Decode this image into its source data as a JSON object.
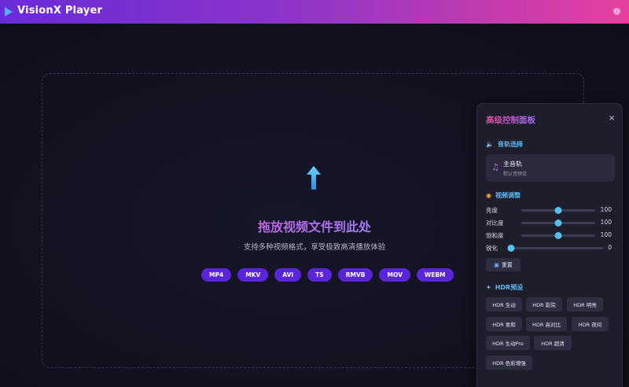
{
  "header": {
    "title": "VisionX Player",
    "logo_icon": "play-triangle-icon",
    "settings_icon": "gear-icon"
  },
  "colors": {
    "header_gradient": [
      "#6a2bd9",
      "#e840a0"
    ],
    "accent_blue": "#56bff2",
    "chip_purple": "#5a25d8"
  },
  "dropzone": {
    "icon": "upload-arrow-icon",
    "title": "拖放视频文件到此处",
    "subtitle": "支持多种视频格式，享受极致高清播放体验",
    "formats": [
      "MP4",
      "MKV",
      "AVI",
      "TS",
      "RMVB",
      "MOV",
      "WEBM"
    ]
  },
  "panel": {
    "title": "高级控制面板",
    "close_label": "×",
    "audio": {
      "heading": "音轨选择",
      "icon": "speaker-icon",
      "track_icon": "music-note-icon",
      "track_name": "主音轨",
      "track_desc": "默认音频流"
    },
    "video": {
      "heading": "视频调整",
      "icon": "palette-icon",
      "rows": [
        {
          "label": "亮度",
          "value": "100",
          "level": 0.5
        },
        {
          "label": "对比度",
          "value": "100",
          "level": 0.5
        },
        {
          "label": "饱和度",
          "value": "100",
          "level": 0.5
        },
        {
          "label": "锐化",
          "value": "0",
          "level": 0.0
        }
      ],
      "reset_label": "重置",
      "reset_icon": "reset-icon"
    },
    "hdr": {
      "heading": "HDR预设",
      "icon": "sparkle-icon",
      "presets": [
        "HDR 生动",
        "HDR 影院",
        "HDR 明亮",
        "HDR 柔和",
        "HDR 高对比",
        "HDR 夜间",
        "HDR 生动Pro",
        "HDR 超清",
        "HDR 色彩增强"
      ]
    }
  }
}
